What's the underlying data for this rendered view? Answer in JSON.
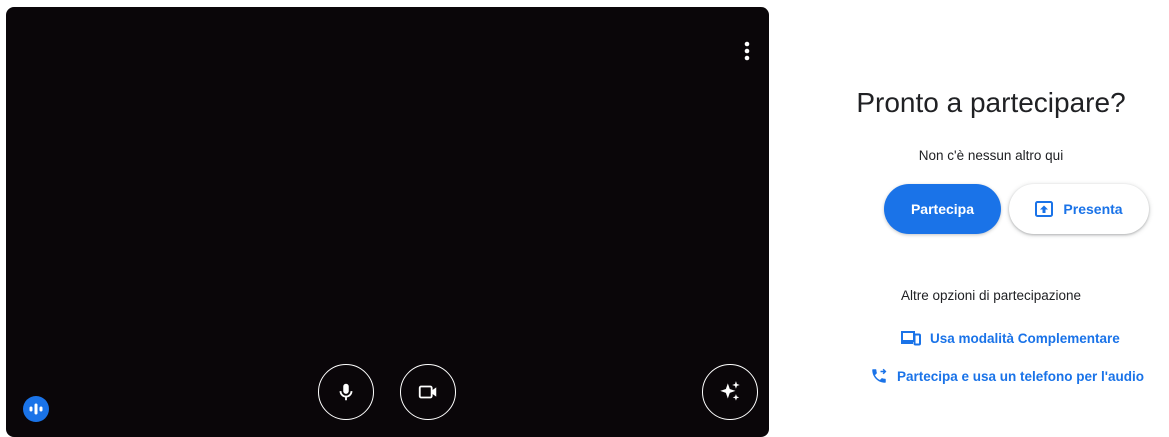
{
  "preview": {
    "more_options_icon": "more-vert-icon",
    "controls": {
      "mic_icon": "mic-icon",
      "camera_icon": "videocam-icon",
      "effects_icon": "sparkle-icon",
      "audio_indicator_icon": "audio-level-icon"
    }
  },
  "join_panel": {
    "title": "Pronto a partecipare?",
    "subtitle": "Non c'è nessun altro qui",
    "join_label": "Partecipa",
    "present_label": "Presenta",
    "present_icon": "present-to-all-icon",
    "other_options_label": "Altre opzioni di partecipazione",
    "options": [
      {
        "label": "Usa modalità Complementare",
        "icon": "devices-icon"
      },
      {
        "label": "Partecipa e usa un telefono per l'audio",
        "icon": "phone-forwarded-icon"
      }
    ]
  },
  "colors": {
    "accent": "#1a73e8",
    "preview_bg": "#0a0609",
    "text": "#202124"
  }
}
